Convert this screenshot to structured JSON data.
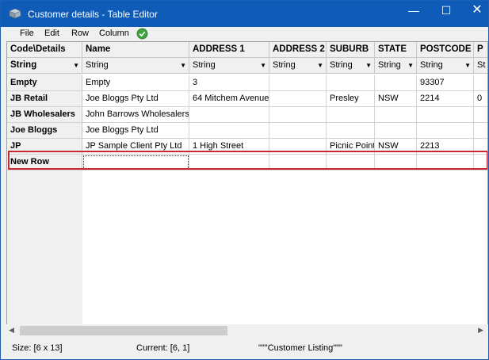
{
  "window": {
    "title": "Customer details - Table Editor",
    "controls": {
      "minimize": "—",
      "maximize": "☐",
      "close": "✕"
    }
  },
  "menu": {
    "file": "File",
    "edit": "Edit",
    "row": "Row",
    "column": "Column"
  },
  "grid": {
    "corner_header": "Code\\Details",
    "corner_type": "String",
    "columns": [
      {
        "header": "Name",
        "type": "String"
      },
      {
        "header": "ADDRESS 1",
        "type": "String"
      },
      {
        "header": "ADDRESS 2",
        "type": "String"
      },
      {
        "header": "SUBURB",
        "type": "String"
      },
      {
        "header": "STATE",
        "type": "String"
      },
      {
        "header": "POSTCODE",
        "type": "String"
      },
      {
        "header": "P",
        "type": "St"
      }
    ],
    "rows": [
      {
        "code": "Empty",
        "cells": [
          "Empty",
          "3",
          "",
          "",
          "",
          "93307",
          ""
        ]
      },
      {
        "code": "JB Retail",
        "cells": [
          "Joe Bloggs Pty Ltd",
          "64 Mitchem Avenue",
          "",
          "Presley",
          "NSW",
          "2214",
          "0"
        ]
      },
      {
        "code": "JB Wholesalers",
        "cells": [
          "John Barrows Wholesalers",
          "",
          "",
          "",
          "",
          "",
          ""
        ]
      },
      {
        "code": "Joe Bloggs",
        "cells": [
          "Joe Bloggs Pty Ltd",
          "",
          "",
          "",
          "",
          "",
          ""
        ]
      },
      {
        "code": "JP",
        "cells": [
          "JP Sample Client Pty Ltd",
          "1 High Street",
          "",
          "Picnic Point",
          "NSW",
          "2213",
          ""
        ]
      },
      {
        "code": "New Row",
        "cells": [
          "",
          "",
          "",
          "",
          "",
          "",
          ""
        ]
      }
    ],
    "highlight_color": "#c8282f"
  },
  "status": {
    "size": "Size: [6 x 13]",
    "current": "Current: [6, 1]",
    "listing": "\"\"\"Customer Listing\"\"\""
  }
}
